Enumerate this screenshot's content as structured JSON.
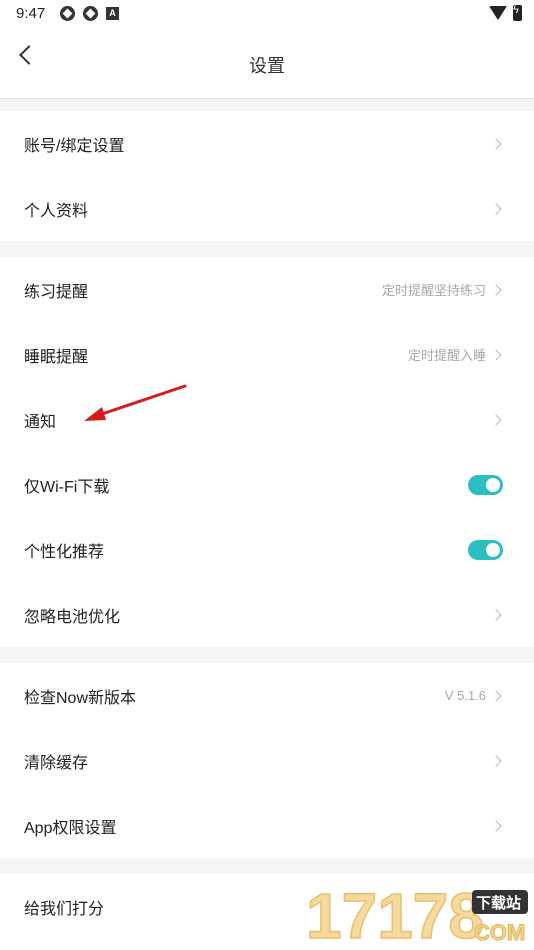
{
  "status_bar": {
    "time": "9:47"
  },
  "header": {
    "title": "设置"
  },
  "groups": [
    {
      "items": [
        {
          "label": "账号/绑定设置",
          "value": ""
        },
        {
          "label": "个人资料",
          "value": ""
        }
      ]
    },
    {
      "items": [
        {
          "label": "练习提醒",
          "value": "定时提醒坚持练习"
        },
        {
          "label": "睡眠提醒",
          "value": "定时提醒入睡"
        },
        {
          "label": "通知",
          "value": ""
        },
        {
          "label": "仅Wi-Fi下载",
          "toggle": true
        },
        {
          "label": "个性化推荐",
          "toggle": true
        },
        {
          "label": "忽略电池优化",
          "value": ""
        }
      ]
    },
    {
      "items": [
        {
          "label": "检查Now新版本",
          "value": "V 5.1.6"
        },
        {
          "label": "清除缓存",
          "value": ""
        },
        {
          "label": "App权限设置",
          "value": ""
        }
      ]
    },
    {
      "items": [
        {
          "label": "给我们打分",
          "value": ""
        }
      ]
    }
  ],
  "watermark": {
    "number": "17178",
    "badge": "下载站",
    "domain": "COM"
  },
  "colors": {
    "toggle_on": "#2bbfc1",
    "annotation_arrow": "#d41c1c"
  }
}
